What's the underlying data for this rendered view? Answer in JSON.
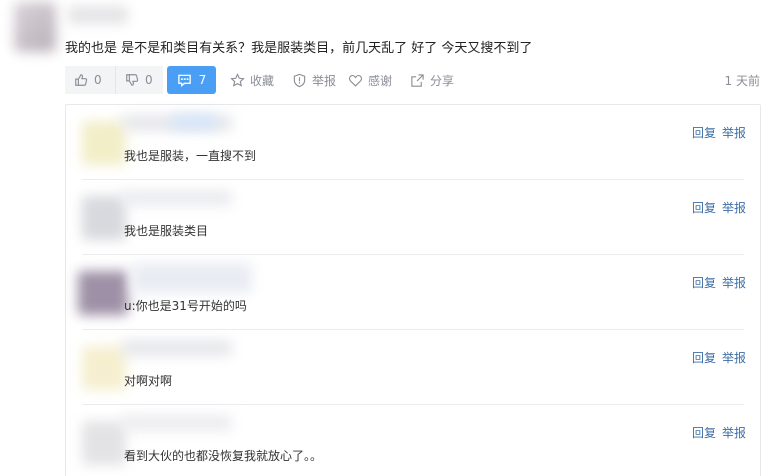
{
  "comment": {
    "text": "我的也是  是不是和类目有关系？我是服装类目，前几天乱了 好了 今天又搜不到了",
    "upvotes": "0",
    "downvotes": "0",
    "reply_count": "7",
    "favorite_label": "收藏",
    "report_label": "举报",
    "thanks_label": "感谢",
    "share_label": "分享",
    "time": "1 天前"
  },
  "replies": [
    {
      "text": "我也是服装，一直搜不到",
      "reply_label": "回复",
      "report_label": "举报"
    },
    {
      "text": "我也是服装类目",
      "reply_label": "回复",
      "report_label": "举报"
    },
    {
      "text": "u:你也是31号开始的吗",
      "reply_label": "回复",
      "report_label": "举报"
    },
    {
      "text": "对啊对啊",
      "reply_label": "回复",
      "report_label": "举报"
    },
    {
      "text": "看到大伙的也都没恢复我就放心了。。",
      "reply_label": "回复",
      "report_label": "举报"
    }
  ],
  "colors": {
    "accent": "#4a9ff5",
    "link": "#3d6ea5",
    "muted": "#8a8e96"
  }
}
